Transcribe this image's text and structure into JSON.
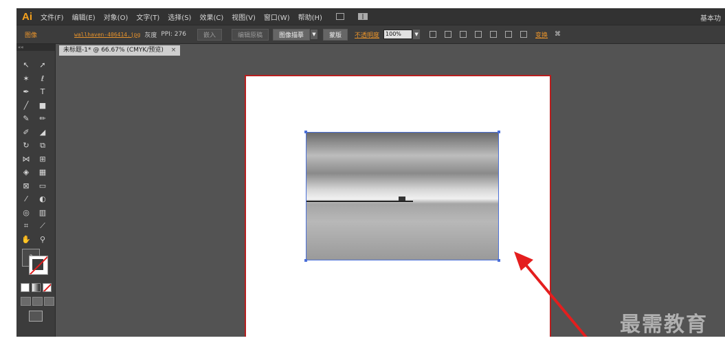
{
  "menubar": {
    "logo": "Ai",
    "items": [
      "文件(F)",
      "编辑(E)",
      "对象(O)",
      "文字(T)",
      "选择(S)",
      "效果(C)",
      "视图(V)",
      "窗口(W)",
      "帮助(H)"
    ],
    "workspace": "基本功"
  },
  "controlbar": {
    "image_label": "图像",
    "filename": "wallhaven-406414.jpg",
    "colormode": "灰度",
    "ppi": "PPI: 276",
    "embed_button": "嵌入",
    "edit_original_button": "编辑原稿",
    "image_trace_button": "图像描摹",
    "mask_button": "蒙版",
    "opacity_label": "不透明度",
    "opacity_value": "100%",
    "transform_label": "变换"
  },
  "toolpanel": {
    "header": "««",
    "fill_question": "?"
  },
  "document": {
    "tab_title": "未标题-1* @ 66.67% (CMYK/预览)",
    "tab_close": "×"
  },
  "watermark": "最需教育",
  "colors": {
    "artboard_border": "#b81e1e",
    "selection": "#4a6fd8",
    "arrow": "#e41e1e",
    "accent": "#e8932b"
  }
}
